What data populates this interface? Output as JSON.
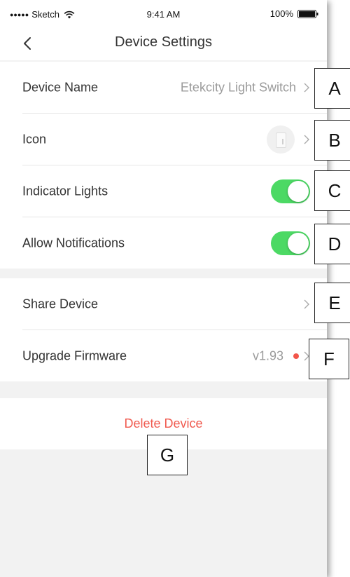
{
  "status_bar": {
    "carrier": "Sketch",
    "time": "9:41 AM",
    "battery": "100%"
  },
  "nav": {
    "back_icon": "chevron-left-icon",
    "title": "Device Settings"
  },
  "settings_group_1": [
    {
      "label": "Device Name",
      "value": "Etekcity Light Switch",
      "control": "chevron"
    },
    {
      "label": "Icon",
      "value": "",
      "control": "chevron",
      "icon": "light-switch-icon"
    },
    {
      "label": "Indicator Lights",
      "control": "toggle",
      "on": true
    },
    {
      "label": "Allow Notifications",
      "control": "toggle",
      "on": true
    }
  ],
  "settings_group_2": [
    {
      "label": "Share Device",
      "control": "chevron"
    },
    {
      "label": "Upgrade Firmware",
      "value": "v1.93",
      "control": "chevron",
      "badge": "red-dot"
    }
  ],
  "delete_label": "Delete Device",
  "annotations": [
    "A",
    "B",
    "C",
    "D",
    "E",
    "F",
    "G"
  ],
  "colors": {
    "toggle_on": "#4cd964",
    "delete": "#f05a4f",
    "badge": "#f2554a"
  }
}
